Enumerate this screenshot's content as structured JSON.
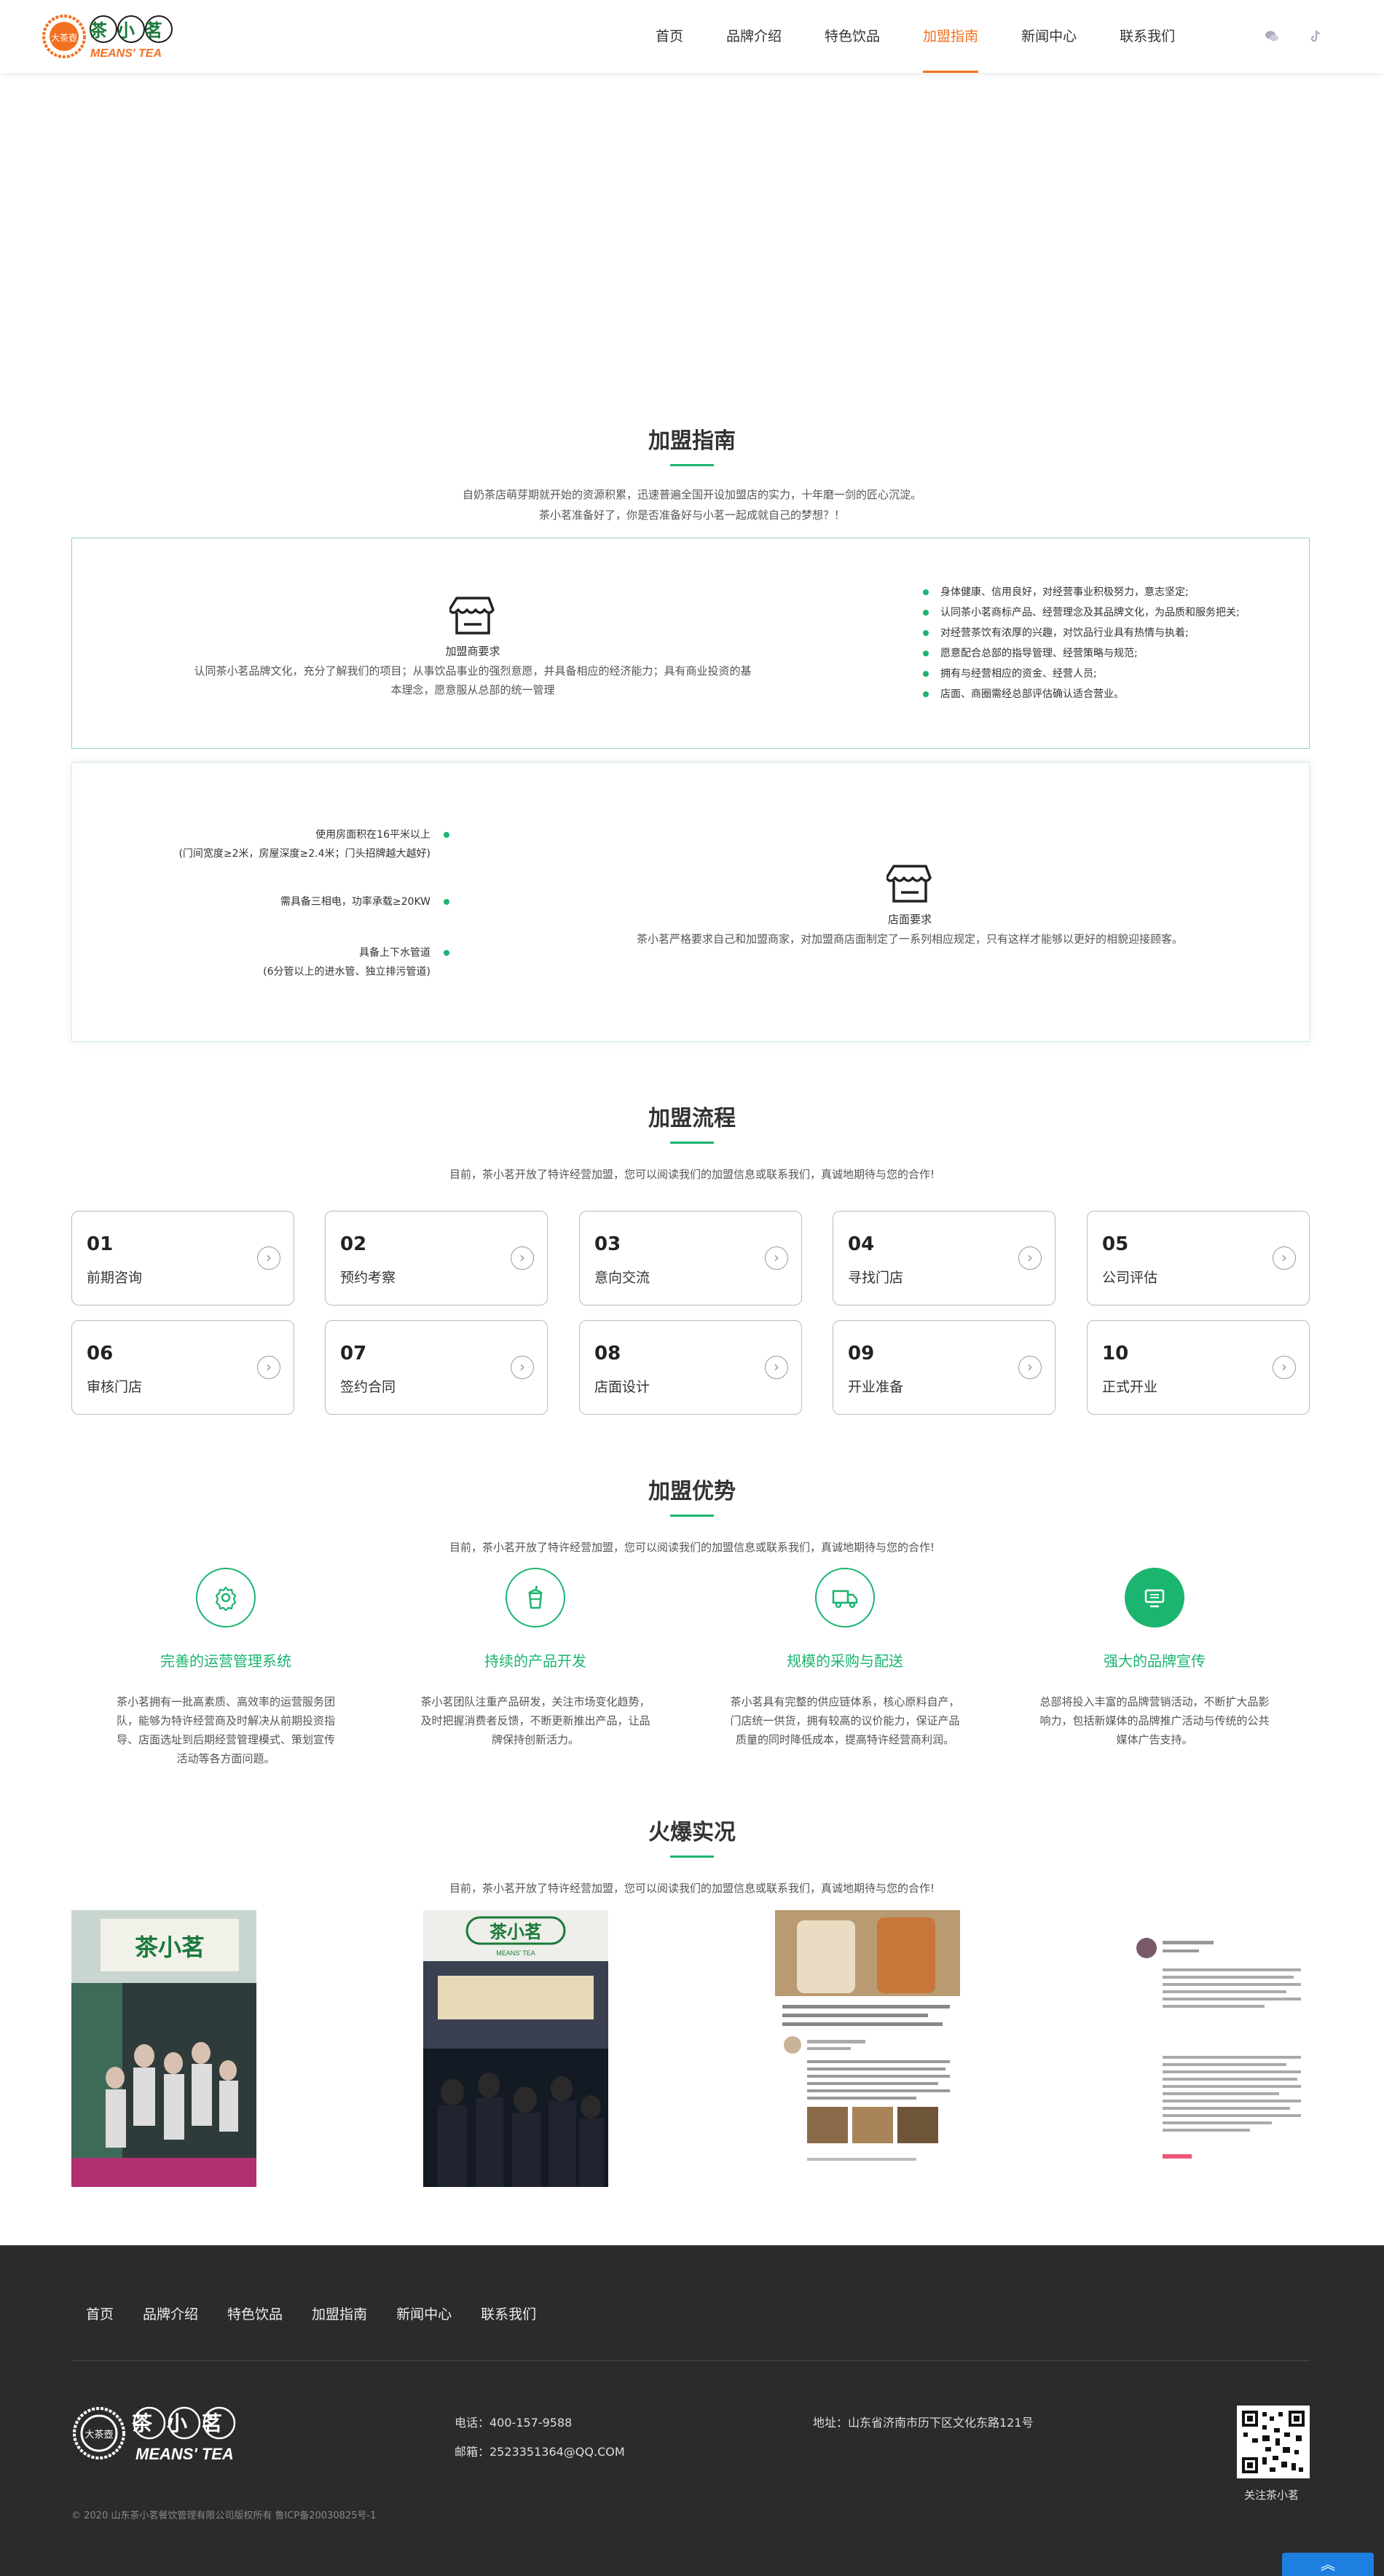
{
  "header": {
    "logo_text": "茶小茗",
    "logo_sub": "MEANS' TEA",
    "logo_seal": "大茶壺",
    "nav": [
      {
        "label": "首页"
      },
      {
        "label": "品牌介绍"
      },
      {
        "label": "特色饮品"
      },
      {
        "label": "加盟指南"
      },
      {
        "label": "新闻中心"
      },
      {
        "label": "联系我们"
      }
    ],
    "active_nav": "加盟指南",
    "icons": [
      "wechat-icon",
      "tiktok-icon"
    ]
  },
  "guide": {
    "title": "加盟指南",
    "desc_line1": "自奶茶店萌芽期就开始的资源积累，迅速普遍全国开设加盟店的实力，十年磨一剑的匠心沉淀。",
    "desc_line2": "茶小茗准备好了，你是否准备好与小茗一起成就自己的梦想？！",
    "franchisee": {
      "label": "加盟商要求",
      "text_line1": "认同茶小茗品牌文化，充分了解我们的项目；从事饮品事业的强烈意愿，并具备相应的经济能力；具有商业投资的基",
      "text_line2": "本理念，愿意服从总部的统一管理",
      "bullets": [
        "身体健康、信用良好，对经营事业积极努力，意志坚定;",
        "认同茶小茗商标产品、经营理念及其品牌文化，为品质和服务把关;",
        "对经营茶饮有浓厚的兴趣，对饮品行业具有热情与执着;",
        "愿意配合总部的指导管理、经营策略与规范;",
        "拥有与经营相应的资金、经营人员;",
        "店面、商圈需经总部评估确认适合营业。"
      ]
    },
    "store": {
      "label": "店面要求",
      "text": "茶小茗严格要求自己和加盟商家，对加盟商店面制定了一系列相应规定，只有这样才能够以更好的相貌迎接顾客。",
      "bullets": [
        {
          "line1": "使用房面积在16平米以上",
          "line2": "(门间宽度≥2米，房屋深度≥2.4米；门头招牌越大越好)"
        },
        {
          "line1": "需具备三相电，功率承载≥20KW",
          "line2": ""
        },
        {
          "line1": "具备上下水管道",
          "line2": "(6分管以上的进水管、独立排污管道)"
        }
      ]
    }
  },
  "process": {
    "title": "加盟流程",
    "desc": "目前，茶小茗开放了特许经营加盟，您可以阅读我们的加盟信息或联系我们，真诚地期待与您的合作!",
    "steps": [
      {
        "num": "01",
        "label": "前期咨询"
      },
      {
        "num": "02",
        "label": "预约考察"
      },
      {
        "num": "03",
        "label": "意向交流"
      },
      {
        "num": "04",
        "label": "寻找门店"
      },
      {
        "num": "05",
        "label": "公司评估"
      },
      {
        "num": "06",
        "label": "审核门店"
      },
      {
        "num": "07",
        "label": "签约合同"
      },
      {
        "num": "08",
        "label": "店面设计"
      },
      {
        "num": "09",
        "label": "开业准备"
      },
      {
        "num": "10",
        "label": "正式开业"
      }
    ]
  },
  "advantages": {
    "title": "加盟优势",
    "desc": "目前，茶小茗开放了特许经营加盟，您可以阅读我们的加盟信息或联系我们，真诚地期待与您的合作!",
    "items": [
      {
        "icon": "gear-icon",
        "title": "完善的运营管理系统",
        "lines": [
          "茶小茗拥有一批高素质、高效率的运营服务团",
          "队，能够为特许经营商及时解决从前期投资指",
          "导、店面选址到后期经营管理模式、策划宣传",
          "活动等各方面问题。"
        ]
      },
      {
        "icon": "cup-icon",
        "title": "持续的产品开发",
        "lines": [
          "茶小茗团队注重产品研发，关注市场变化趋势，",
          "及时把握消费者反馈，不断更新推出产品，让品",
          "牌保持创新活力。"
        ]
      },
      {
        "icon": "truck-icon",
        "title": "规模的采购与配送",
        "lines": [
          "茶小茗具有完整的供应链体系，核心原料自产，",
          "门店统一供货，拥有较高的议价能力，保证产品",
          "质量的同时降低成本，提高特许经营商利润。"
        ]
      },
      {
        "icon": "monitor-icon",
        "title": "强大的品牌宣传",
        "lines": [
          "总部将投入丰富的品牌营销活动，不断扩大品影",
          "响力，包括新媒体的品牌推广活动与传统的公共",
          "媒体广告支持。"
        ]
      }
    ]
  },
  "showcase": {
    "title": "火爆实况",
    "desc": "目前，茶小茗开放了特许经营加盟，您可以阅读我们的加盟信息或联系我们，真诚地期待与您的合作!",
    "photo_sign": "茶小茗",
    "photo_sign_sub": "MEANS' TEA"
  },
  "footer": {
    "nav": [
      "首页",
      "品牌介绍",
      "特色饮品",
      "加盟指南",
      "新闻中心",
      "联系我们"
    ],
    "phone": "电话：400-157-9588",
    "email": "邮箱：2523351364@QQ.COM",
    "address": "地址：山东省济南市历下区文化东路121号",
    "qr_label": "关注茶小茗",
    "copyright": "© 2020 山东茶小茗餐饮管理有限公司版权所有 鲁ICP备20030825号-1"
  },
  "colors": {
    "accent": "#1bb56f",
    "brand_orange": "#f37021",
    "footer_bg": "#2b2b2b"
  }
}
